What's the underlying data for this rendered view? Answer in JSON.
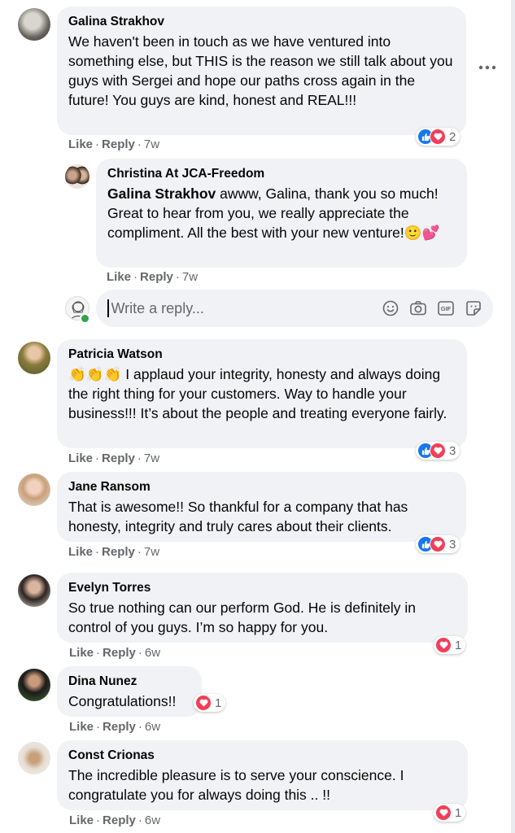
{
  "comments": [
    {
      "name": "Galina Strakhov",
      "text": "We haven't been in touch as we have ventured into something else, but THIS is the reason we still talk about you guys with Sergei and hope our paths cross again in the future! You guys are kind, honest and REAL!!!",
      "like_label": "Like",
      "reply_label": "Reply",
      "time": "7w",
      "reaction_count": "2"
    },
    {
      "name": "Christina At JCA-Freedom",
      "mention": "Galina Strakhov",
      "text": "awww, Galina, thank you so much! Great to hear from you, we really appreciate the compliment. All the best with your new venture!",
      "emoji": "🙂💕",
      "like_label": "Like",
      "reply_label": "Reply",
      "time": "7w"
    },
    {
      "name": "Patricia Watson",
      "emoji": "👏👏👏",
      "text": "I applaud your integrity, honesty and always doing the right thing for your customers. Way to handle your business!!! It’s about the people and treating everyone fairly.",
      "like_label": "Like",
      "reply_label": "Reply",
      "time": "7w",
      "reaction_count": "3"
    },
    {
      "name": "Jane Ransom",
      "text": "That is awesome!! So thankful for a company that has honesty, integrity and truly cares about their clients.",
      "like_label": "Like",
      "reply_label": "Reply",
      "time": "7w",
      "reaction_count": "3"
    },
    {
      "name": "Evelyn Torres",
      "text": "So true nothing can our perform God. He is definitely in control of you guys. I’m so happy for you.",
      "like_label": "Like",
      "reply_label": "Reply",
      "time": "6w",
      "reaction_count": "1"
    },
    {
      "name": "Dina Nunez",
      "text": "Congratulations!!",
      "like_label": "Like",
      "reply_label": "Reply",
      "time": "6w",
      "reaction_count": "1"
    },
    {
      "name": "Const Crionas",
      "text": "The incredible pleasure is to serve your conscience. I congratulate you for always doing this .. !!",
      "like_label": "Like",
      "reply_label": "Reply",
      "time": "6w",
      "reaction_count": "1"
    }
  ],
  "reply_box": {
    "placeholder": "Write a reply...",
    "tools": [
      "emoji-icon",
      "camera-icon",
      "gif-icon",
      "sticker-icon"
    ]
  },
  "icons": {
    "more": "more-options-icon",
    "like_reaction": "like-reaction-icon",
    "love_reaction": "love-reaction-icon"
  },
  "colors": {
    "bubble": "#f0f2f5",
    "meta": "#65676b",
    "like_blue": "#1877f2",
    "love_red": "#f33e58",
    "online_green": "#31a24c"
  }
}
